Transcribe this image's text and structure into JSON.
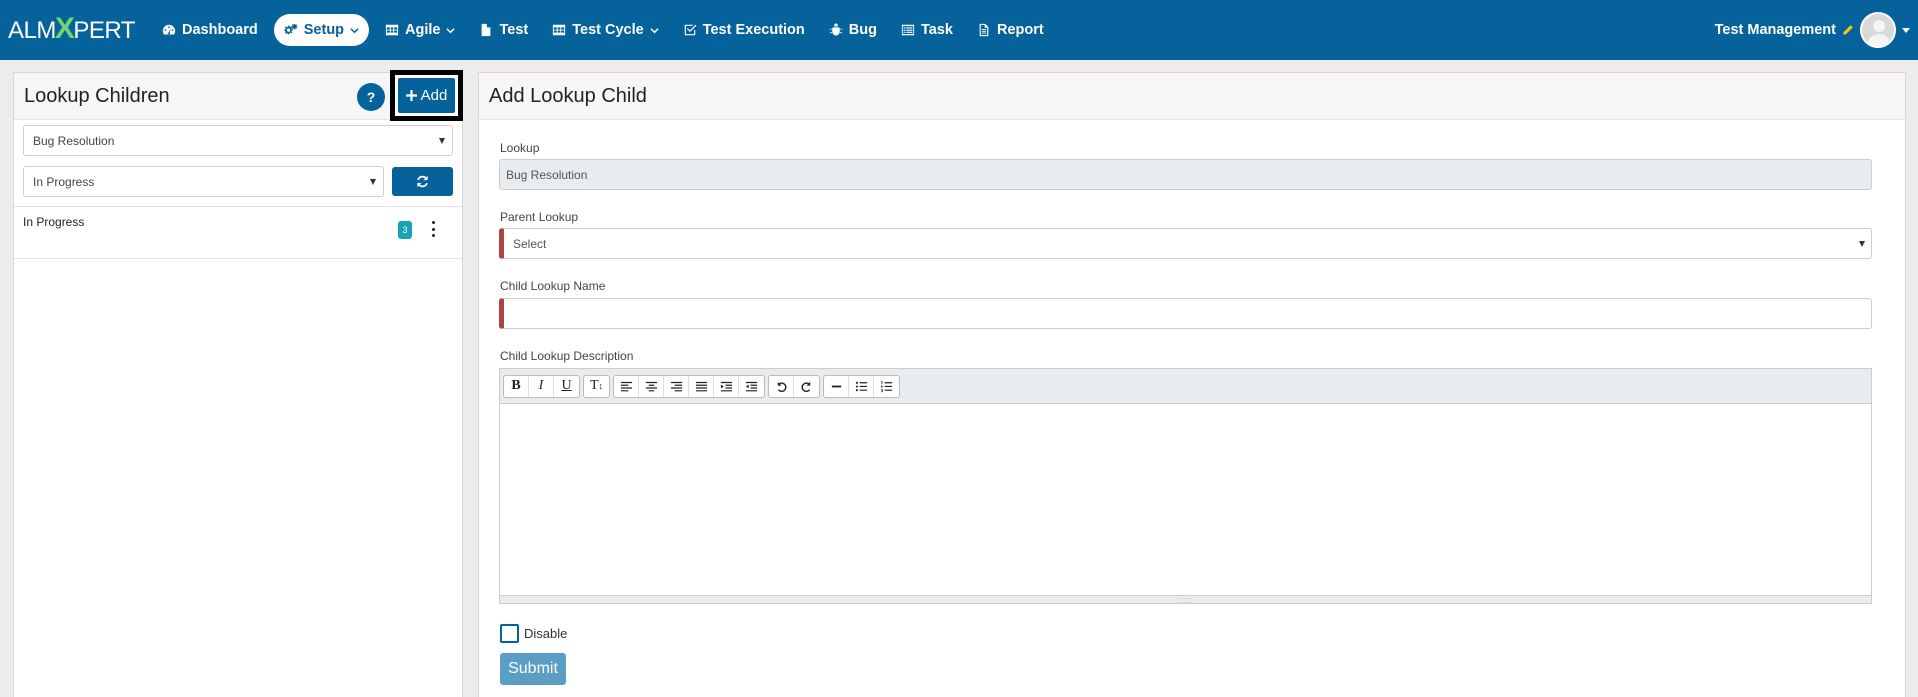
{
  "brand": {
    "logo_text_1": "ALM",
    "logo_x": "X",
    "logo_text_2": "PERT"
  },
  "nav": {
    "items": [
      {
        "label": "Dashboard",
        "icon": "dashboard-icon"
      },
      {
        "label": "Setup",
        "icon": "cogs-icon",
        "active": true,
        "dropdown": true
      },
      {
        "label": "Agile",
        "icon": "table-icon",
        "dropdown": true
      },
      {
        "label": "Test",
        "icon": "file-icon"
      },
      {
        "label": "Test Cycle",
        "icon": "table-icon",
        "dropdown": true
      },
      {
        "label": "Test Execution",
        "icon": "check-square-icon"
      },
      {
        "label": "Bug",
        "icon": "bug-icon"
      },
      {
        "label": "Task",
        "icon": "list-alt-icon"
      },
      {
        "label": "Report",
        "icon": "file-text-icon"
      }
    ],
    "project_name": "Test Management"
  },
  "left_panel": {
    "title": "Lookup Children",
    "help_label": "?",
    "add_label": "Add",
    "lookup_select": "Bug Resolution",
    "status_select": "In Progress",
    "list": [
      {
        "label": "In Progress",
        "count": "3"
      }
    ]
  },
  "right_panel": {
    "title": "Add Lookup Child",
    "lookup_label": "Lookup",
    "lookup_value": "Bug Resolution",
    "parent_label": "Parent Lookup",
    "parent_value": "Select",
    "child_name_label": "Child Lookup Name",
    "child_name_value": "",
    "child_desc_label": "Child Lookup Description",
    "disable_label": "Disable",
    "submit_label": "Submit"
  },
  "colors": {
    "primary": "#05629a",
    "required": "#a94442",
    "badge": "#17a2b8",
    "submit": "#5b9ec5"
  }
}
